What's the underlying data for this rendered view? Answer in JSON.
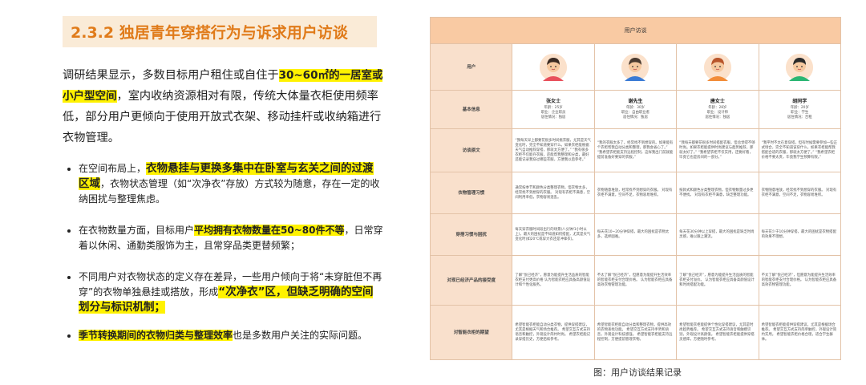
{
  "left": {
    "title": "2.3.2 独居青年穿搭行为与诉求用户访谈",
    "intro_pre": "调研结果显示，多数目标用户租住或自住于",
    "intro_hl": "30~60㎡的一居室或小户型空间",
    "intro_post": "，室内收纳资源相对有限，传统大体量衣柜使用频率低，部分用户更倾向于使用开放式衣架、移动挂杆或收纳箱进行衣物管理。",
    "b1_pre": "在空间布局上，",
    "b1_hl": "衣物悬挂与更换多集中在卧室与玄关之间的过渡区域",
    "b1_post": "，衣物状态管理（如“次净衣”存放）方式较为随意，存在一定的收纳困扰与整理焦虑。",
    "b2_pre": "在衣物数量方面，目标用户",
    "b2_hl": "平均拥有衣物数量在50~80件不等",
    "b2_post": "，日常穿着以休闲、通勤类服饰为主，且常穿品类更替频繁；",
    "b3_pre": "不同用户对衣物状态的定义存在差异，一些用户倾向于将“未穿脏但不再穿”的衣物单独悬挂或搭放，形成",
    "b3_hl": "“次净衣”区，但缺乏明确的空间划分与标识机制；",
    "b4_hl": "季节转换期间的衣物归类与整理效率",
    "b4_post": "也是多数用户关注的实际问题。"
  },
  "table": {
    "header": "用户访谈",
    "row_labels": [
      "用户",
      "基本信息",
      "访谈原文",
      "衣物管理习惯",
      "穿搭习惯与困扰",
      "对现已经济产品的接受度",
      "对智能衣柜的期望"
    ],
    "users": [
      {
        "name": "张女士",
        "info": [
          "年龄：25岁",
          "职业：企业职员",
          "居住情况：独居"
        ],
        "hair": "#3a2a22",
        "shirt": "#e8505b"
      },
      {
        "name": "谢先生",
        "info": [
          "年龄：30岁",
          "职业：自由职业者",
          "居住情况：独居"
        ],
        "hair": "#4a3a30",
        "shirt": "#3a7bd5"
      },
      {
        "name": "唐女士",
        "info": [
          "年龄：28岁",
          "职业：设计师",
          "居住情况：独居"
        ],
        "hair": "#b8552b",
        "shirt": "#f28c38"
      },
      {
        "name": "胡同学",
        "info": [
          "年龄：20岁",
          "职业：学生",
          "居住情况：合租"
        ],
        "hair": "#2a2a2a",
        "shirt": "#2bb673"
      }
    ],
    "rows": [
      [
        "“我每天早上都要花很多时间挑衣服，尤其是天气变化时，完全不知道要穿什么。如果衣柜能根据天气自动推荐穿搭，那就太方便了。” “我有很多衣柜不仅能存衣服，还能帮我整理和分类，最好还能记录我穿过哪些衣服，方便我以后参考。”",
        "“我的衣服太多了，经常找不到想穿的。如果能有个衣柜帮我自动分类和整理，那我会省心了。” “我希望衣柜能支持远程控制，这样我出门前就能提前准备好要穿的衣服。”",
        "“我每天都要花很多时间搭配衣服，但总觉得不够时尚。如果衣柜能提供时尚建议与趋势推荐，那就太好了。” “我希望衣柜不仅实用，还要好看，毕竟它也是房间的一部分。”",
        "“我平时不太在意穿搭，但有时候需要参加一些正式场合，完全不知道该穿什么。如果衣柜能帮我搭配合适的衣服，那就太方便了。” “我希望衣柜价格不要太贵，毕竟我学生预算有限。”"
      ],
      [
        "通常按季节和颜色分类整理衣物，但衣物太多，经常找不到想穿的衣服。 对现有衣柜不满意，空间利用率低，衣物容易混乱。",
        "衣物随意堆放，经常找不到想穿的衣服。 对现有衣柜不满意，空间不足，衣物容易堆积。",
        "按款式和颜色分类整理衣物，但衣物数量过多更不便找。 对现有衣柜不满意，缺乏整理功能。",
        "衣物随意堆放，经常找不到想穿的衣服。 对现有衣柜不满意，空间不足，衣物容易堆积。"
      ],
      [
        "每天穿衣服时间段出行的场景(八分钟/1小时以上)，最大的困扰是不知道如何搭配，尤其是天气变化时(如20℃或穿大衣还是冲锋衣)。",
        "每天花10~20分钟穿搭，最大的困扰是衣物太多，选择困难。",
        "每天花30分钟以上穿搭，最大的困扰是缺乏时尚灵感，难以跟上潮流。",
        "每天花少于10分钟穿搭，最大的困扰是衣物搭配的效果不理想。"
      ],
      [
        "了解“悦己经济”，愿意为能提升生活品质的智能衣柜支付更高价格 认为智能衣柜应具备高颜值设计和个性化服务。",
        "不太了解“悦己经济”，但愿意为能提升生活效率的智能衣柜支付合理价格。 认为智能衣柜应具备高效衣物管理功能。",
        "了解“悦己经济”，愿意为能提升生活品质的智能衣柜支付溢价。 认为智能衣柜应具备高颜值设计和时尚搭配功能。",
        "不太了解“悦己经济”，但愿意为能提升生活效率的智能衣柜支付合理价格。 认为智能衣柜应具备高效衣物管理功能。"
      ],
      [
        "希望智能衣柜能自动分类衣物，提供穿搭建议，尤其是根据天气和场合推荐。 希望交互方式支持语音和触控，外观设计简约时尚。 希望衣柜能记录穿搭历史，方便后续参考。",
        "希望智能衣柜能自动分类和整理衣物，提供高效的衣物查找功能。 希望交互方式支持手势和语音，外观设计科技感强。 希望智能衣柜能支持远程控制，方便提前管理衣物。",
        "希望智能衣柜能提供个性化穿搭建议，尤其是时尚趋势推荐。 希望交互方式支持语音和触摸识别，外观设计高颜值。 希望智能衣柜能提供穿搭灵感库，方便随时参考。",
        "希望智能衣柜能提供穿搭建议，尤其是根据场合推荐。 希望交互方式支持简单触控，外观设计简约实用。 希望智能衣柜价格合理，适合学生群体。"
      ]
    ]
  },
  "caption": "图：用户访谈结果记录"
}
